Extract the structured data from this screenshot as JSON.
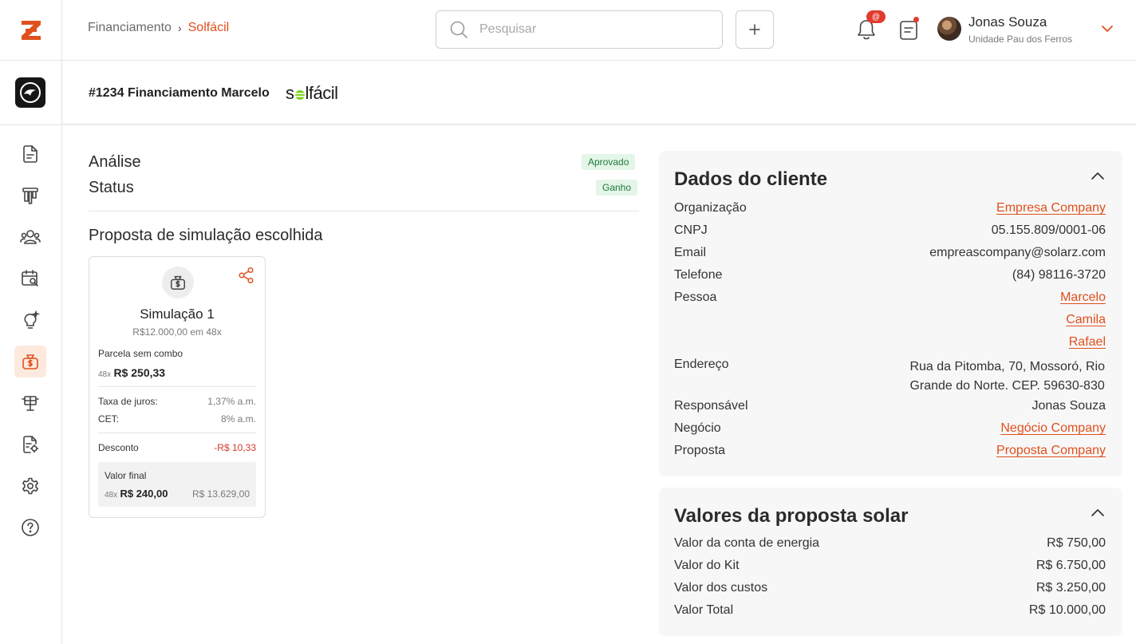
{
  "breadcrumb": {
    "parent": "Financiamento",
    "separator": "›",
    "current": "Solfácil"
  },
  "search": {
    "placeholder": "Pesquisar"
  },
  "notifications": {
    "badge": "@"
  },
  "user": {
    "name": "Jonas Souza",
    "unit": "Unidade Pau dos Ferros"
  },
  "header": {
    "title": "#1234 Financiamento Marcelo",
    "brand": {
      "before": "s",
      "after": "lfácil"
    }
  },
  "analysis": {
    "analise_label": "Análise",
    "analise_badge": "Aprovado",
    "status_label": "Status",
    "status_badge": "Ganho",
    "section_title": "Proposta de simulação escolhida"
  },
  "simulation": {
    "title": "Simulação 1",
    "subtitle": "R$12.000,00 em 48x",
    "installment_label": "Parcela sem combo",
    "installment_count": "48x",
    "installment_value": "R$ 250,33",
    "interest_label": "Taxa de juros:",
    "interest_value": "1,37% a.m.",
    "cet_label": "CET:",
    "cet_value": "8% a.m.",
    "discount_label": "Desconto",
    "discount_value": "-R$ 10,33",
    "final_label": "Valor final",
    "final_count": "48x",
    "final_installment": "R$ 240,00",
    "final_total": "R$ 13.629,00"
  },
  "client": {
    "title": "Dados do cliente",
    "organizacao_label": "Organização",
    "organizacao_value": "Empresa Company",
    "cnpj_label": "CNPJ",
    "cnpj_value": "05.155.809/0001-06",
    "email_label": "Email",
    "email_value": "empreascompany@solarz.com",
    "telefone_label": "Telefone",
    "telefone_value": "(84) 98116-3720",
    "pessoa_label": "Pessoa",
    "pessoas": [
      "Marcelo",
      "Camila",
      "Rafael"
    ],
    "endereco_label": "Endereço",
    "endereco_line1": "Rua da Pitomba, 70, Mossoró, Rio",
    "endereco_line2": "Grande do Norte. CEP. 59630-830",
    "responsavel_label": "Responsável",
    "responsavel_value": "Jonas Souza",
    "negocio_label": "Negócio",
    "negocio_value": "Negócio Company",
    "proposta_label": "Proposta",
    "proposta_value": "Proposta Company"
  },
  "solar": {
    "title": "Valores da proposta solar",
    "conta_label": "Valor da conta de energia",
    "conta_value": "R$ 750,00",
    "kit_label": "Valor do Kit",
    "kit_value": "R$ 6.750,00",
    "custos_label": "Valor dos custos",
    "custos_value": "R$ 3.250,00",
    "total_label": "Valor Total",
    "total_value": "R$ 10.000,00"
  },
  "colors": {
    "accent": "#e0501e",
    "success_bg": "#e4f6e8",
    "success_text": "#1f7a3a",
    "danger": "#d03a2a",
    "panel_bg": "#f7f7f7"
  },
  "icons": {
    "sidebar": [
      "document-icon",
      "kanban-icon",
      "people-icon",
      "calendar-search-icon",
      "lightbulb-icon",
      "money-bag-icon",
      "solar-panel-icon",
      "document-gear-icon",
      "gear-icon",
      "help-icon"
    ]
  }
}
